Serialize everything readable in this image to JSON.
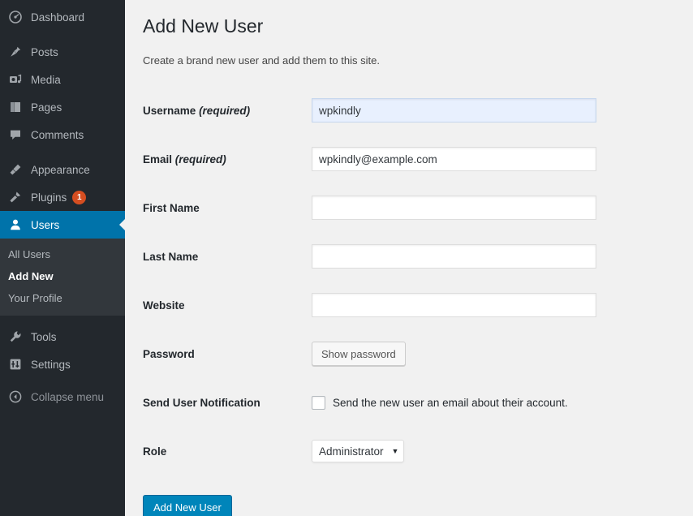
{
  "sidebar": {
    "items": [
      {
        "label": "Dashboard",
        "icon": "dashboard-icon",
        "active": false,
        "badge": null
      },
      {
        "label": "Posts",
        "icon": "pin-icon",
        "active": false,
        "badge": null
      },
      {
        "label": "Media",
        "icon": "media-icon",
        "active": false,
        "badge": null
      },
      {
        "label": "Pages",
        "icon": "pages-icon",
        "active": false,
        "badge": null
      },
      {
        "label": "Comments",
        "icon": "comment-icon",
        "active": false,
        "badge": null
      },
      {
        "label": "Appearance",
        "icon": "brush-icon",
        "active": false,
        "badge": null
      },
      {
        "label": "Plugins",
        "icon": "plug-icon",
        "active": false,
        "badge": "1"
      },
      {
        "label": "Users",
        "icon": "user-icon",
        "active": true,
        "badge": null
      },
      {
        "label": "Tools",
        "icon": "wrench-icon",
        "active": false,
        "badge": null
      },
      {
        "label": "Settings",
        "icon": "settings-icon",
        "active": false,
        "badge": null
      },
      {
        "label": "Collapse menu",
        "icon": "collapse-icon",
        "active": false,
        "badge": null
      }
    ],
    "submenu": [
      {
        "label": "All Users",
        "current": false
      },
      {
        "label": "Add New",
        "current": true
      },
      {
        "label": "Your Profile",
        "current": false
      }
    ],
    "colors": {
      "background": "#23282d",
      "submenu_background": "#32373c",
      "active_background": "#0073aa",
      "badge_background": "#d54e21"
    }
  },
  "main": {
    "title": "Add New User",
    "description": "Create a brand new user and add them to this site.",
    "fields": {
      "username": {
        "label": "Username",
        "required_note": "(required)",
        "value": "wpkindly",
        "placeholder": ""
      },
      "email": {
        "label": "Email",
        "required_note": "(required)",
        "value": "wpkindly@example.com",
        "placeholder": ""
      },
      "first_name": {
        "label": "First Name",
        "value": "",
        "placeholder": ""
      },
      "last_name": {
        "label": "Last Name",
        "value": "",
        "placeholder": ""
      },
      "website": {
        "label": "Website",
        "value": "",
        "placeholder": ""
      },
      "password": {
        "label": "Password",
        "button_label": "Show password"
      },
      "notification": {
        "label": "Send User Notification",
        "checkbox_label": "Send the new user an email about their account.",
        "checked": false
      },
      "role": {
        "label": "Role",
        "value": "Administrator",
        "caret": "▼",
        "options": [
          "Administrator"
        ]
      }
    },
    "submit_label": "Add New User",
    "colors": {
      "primary_button": "#0085ba",
      "autofill_field": "#e8f0fe",
      "page_background": "#f1f1f1"
    }
  }
}
